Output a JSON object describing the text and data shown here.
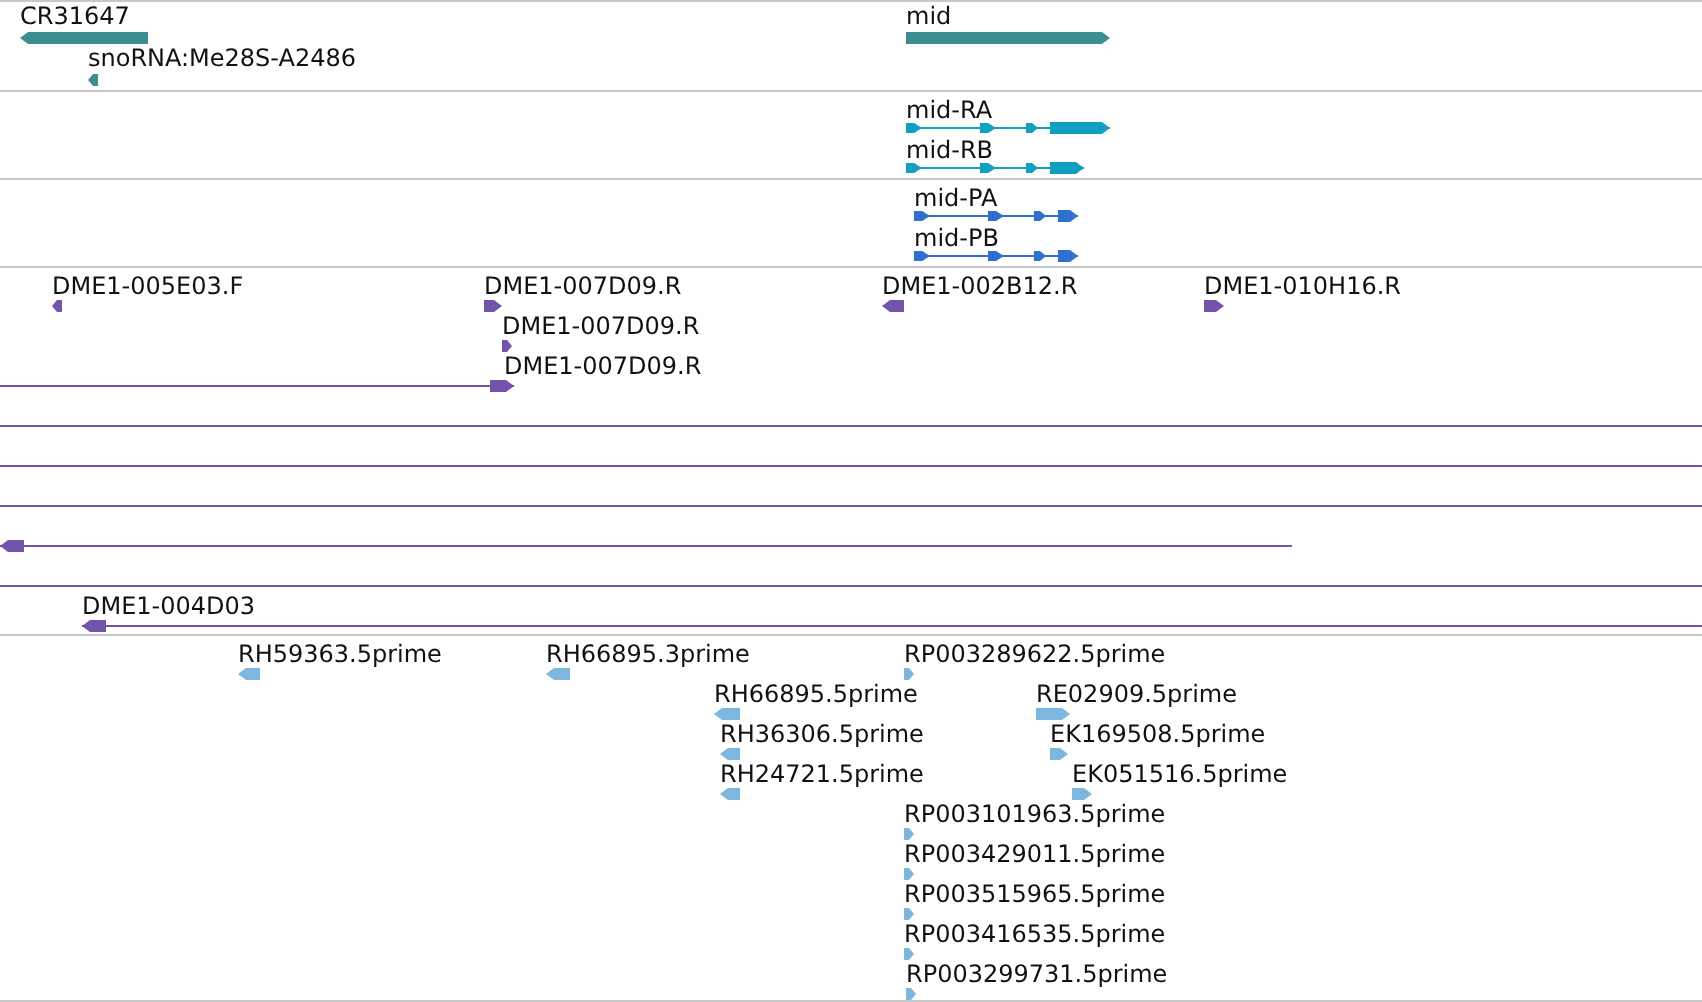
{
  "tracks": [
    {
      "color": "#3b8f91",
      "features": [
        {
          "label": "CR31647",
          "kind": "block",
          "forward": false
        },
        {
          "label": "snoRNA:Me28S-A2486",
          "kind": "block",
          "forward": false
        },
        {
          "label": "mid",
          "kind": "block",
          "forward": true
        }
      ]
    },
    {
      "color": "#12a0c2",
      "features": [
        {
          "label": "mid-RA",
          "kind": "transcript",
          "forward": true
        },
        {
          "label": "mid-RB",
          "kind": "transcript",
          "forward": true
        }
      ]
    },
    {
      "color": "#2f6fd0",
      "features": [
        {
          "label": "mid-PA",
          "kind": "transcript",
          "forward": true
        },
        {
          "label": "mid-PB",
          "kind": "transcript",
          "forward": true
        }
      ]
    },
    {
      "color": "#7454aa",
      "features": [
        {
          "label": "DME1-005E03.F",
          "kind": "block",
          "forward": false
        },
        {
          "label": "DME1-007D09.R",
          "kind": "block",
          "forward": true
        },
        {
          "label": "DME1-007D09.R",
          "kind": "block",
          "forward": true
        },
        {
          "label": "DME1-007D09.R",
          "kind": "alignment",
          "forward": true
        },
        {
          "label": "DME1-002B12.R",
          "kind": "block",
          "forward": false
        },
        {
          "label": "DME1-010H16.R",
          "kind": "block",
          "forward": true
        },
        {
          "kind": "alignment"
        },
        {
          "kind": "alignment"
        },
        {
          "kind": "alignment"
        },
        {
          "kind": "alignment",
          "forward": false
        },
        {
          "kind": "alignment"
        },
        {
          "label": "DME1-004D03",
          "kind": "alignment",
          "forward": false
        }
      ]
    },
    {
      "color": "#7db6de",
      "features": [
        {
          "label": "RH59363.5prime",
          "kind": "block",
          "forward": false
        },
        {
          "label": "RH66895.3prime",
          "kind": "block",
          "forward": false
        },
        {
          "label": "RP003289622.5prime",
          "kind": "block",
          "forward": true
        },
        {
          "label": "RH66895.5prime",
          "kind": "block",
          "forward": false
        },
        {
          "label": "RE02909.5prime",
          "kind": "block",
          "forward": true
        },
        {
          "label": "RH36306.5prime",
          "kind": "block",
          "forward": false
        },
        {
          "label": "EK169508.5prime",
          "kind": "block",
          "forward": true
        },
        {
          "label": "RH24721.5prime",
          "kind": "block",
          "forward": false
        },
        {
          "label": "EK051516.5prime",
          "kind": "block",
          "forward": true
        },
        {
          "label": "RP003101963.5prime",
          "kind": "block",
          "forward": true
        },
        {
          "label": "RP003429011.5prime",
          "kind": "block",
          "forward": true
        },
        {
          "label": "RP003515965.5prime",
          "kind": "block",
          "forward": true
        },
        {
          "label": "RP003416535.5prime",
          "kind": "block",
          "forward": true
        },
        {
          "label": "RP003299731.5prime",
          "kind": "block",
          "forward": true
        }
      ]
    }
  ]
}
